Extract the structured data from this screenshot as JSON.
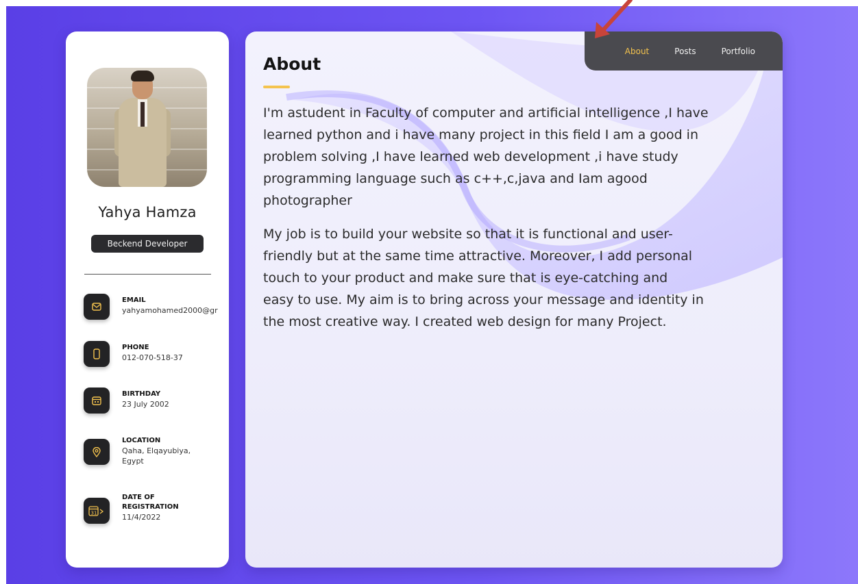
{
  "sidebar": {
    "name": "Yahya Hamza",
    "role": "Beckend Developer",
    "contacts": [
      {
        "label": "EMAIL",
        "value": "yahyamohamed2000@gr",
        "icon": "mail-icon"
      },
      {
        "label": "PHONE",
        "value": "012-070-518-37",
        "icon": "phone-icon"
      },
      {
        "label": "BIRTHDAY",
        "value": "23 July 2002",
        "icon": "calendar-icon"
      },
      {
        "label": "LOCATION",
        "value": "Qaha, Elqayubiya,",
        "value2": "Egypt",
        "icon": "location-pin-icon"
      },
      {
        "label": "DATE OF",
        "label2": "REGISTRATION",
        "value": "11/4/2022",
        "icon": "calendar-31-icon"
      }
    ]
  },
  "nav": {
    "items": [
      {
        "label": "About",
        "active": true
      },
      {
        "label": "Posts",
        "active": false
      },
      {
        "label": "Portfolio",
        "active": false
      }
    ]
  },
  "main": {
    "title": "About",
    "paragraph1_lines": [
      "I'm astudent in Faculty of computer and artificial intelligence ,I have",
      "learned python and i have many project in this field I am a good in",
      "problem solving ,I have learned web development ,i have study",
      "programming language such as c++,c,java and Iam agood",
      "photographer"
    ],
    "paragraph2_lines": [
      "My job is to build your website so that it is functional and user-",
      "friendly but at the same time attractive. Moreover, I add personal",
      "touch to your product and make sure that is eye-catching and",
      "easy to use. My aim is to bring across your message and identity in",
      "the most creative way. I created web design for many Project."
    ]
  },
  "colors": {
    "accent": "#f4c34e",
    "background": "#6d55f3",
    "dark": "#232325",
    "nav_bg": "#4a4a4f"
  }
}
